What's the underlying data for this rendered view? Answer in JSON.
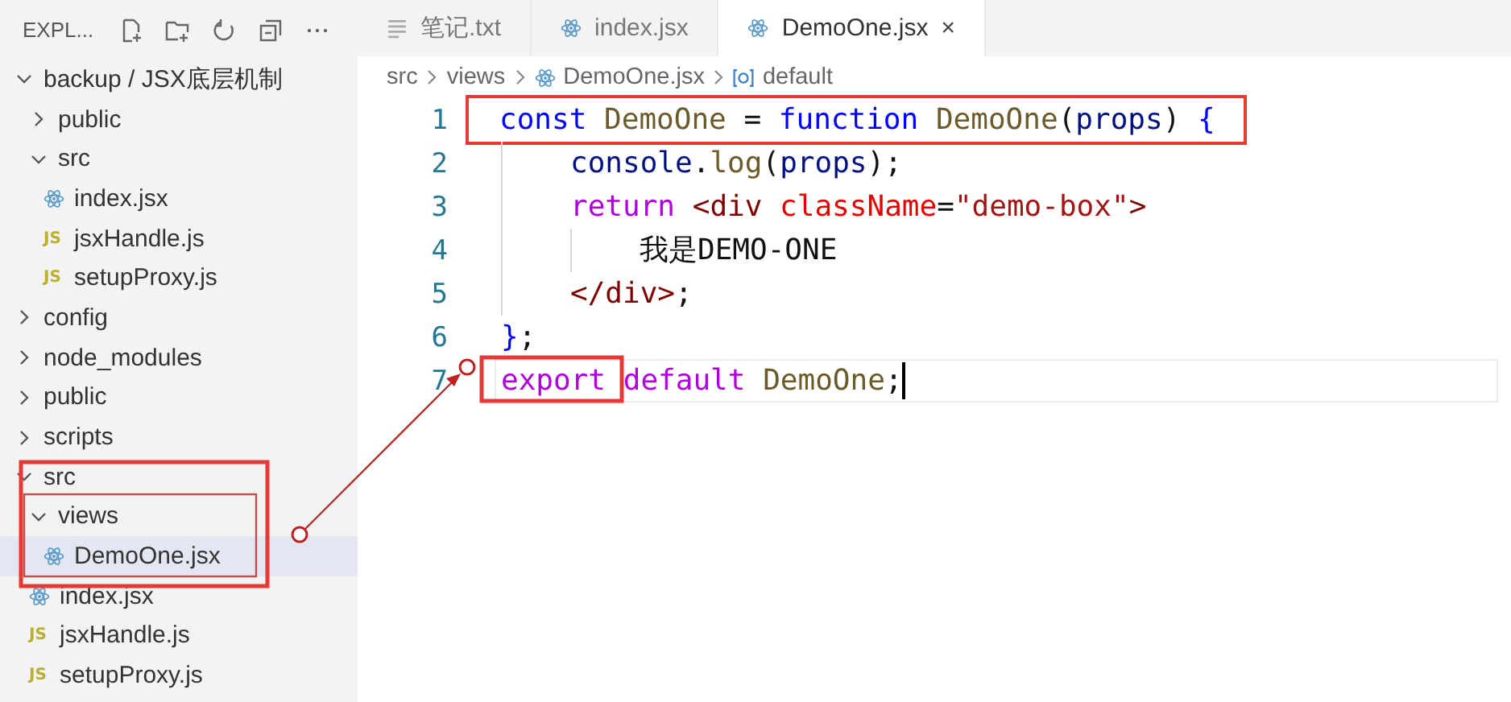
{
  "sidebar": {
    "title": "EXPL...",
    "tree": [
      {
        "label": "backup / JSX底层机制",
        "kind": "folder",
        "expanded": true,
        "selected": false,
        "children": [
          {
            "label": "public",
            "kind": "folder",
            "expanded": false,
            "selected": false
          },
          {
            "label": "src",
            "kind": "folder",
            "expanded": true,
            "selected": false,
            "children": [
              {
                "label": "index.jsx",
                "kind": "jsx",
                "selected": false
              },
              {
                "label": "jsxHandle.js",
                "kind": "js",
                "badge": "JS",
                "selected": false
              },
              {
                "label": "setupProxy.js",
                "kind": "js",
                "badge": "JS",
                "selected": false
              }
            ]
          }
        ]
      },
      {
        "label": "config",
        "kind": "folder",
        "expanded": false,
        "selected": false
      },
      {
        "label": "node_modules",
        "kind": "folder",
        "expanded": false,
        "selected": false
      },
      {
        "label": "public",
        "kind": "folder",
        "expanded": false,
        "selected": false
      },
      {
        "label": "scripts",
        "kind": "folder",
        "expanded": false,
        "selected": false
      },
      {
        "label": "src",
        "kind": "folder",
        "expanded": true,
        "selected": false,
        "children": [
          {
            "label": "views",
            "kind": "folder",
            "expanded": true,
            "selected": false,
            "children": [
              {
                "label": "DemoOne.jsx",
                "kind": "jsx",
                "selected": true
              }
            ]
          },
          {
            "label": "index.jsx",
            "kind": "jsx",
            "selected": false
          },
          {
            "label": "jsxHandle.js",
            "kind": "js",
            "badge": "JS",
            "selected": false
          },
          {
            "label": "setupProxy.js",
            "kind": "js",
            "badge": "JS",
            "selected": false
          }
        ]
      }
    ]
  },
  "tabs": [
    {
      "label": "笔记.txt",
      "kind": "txt",
      "selected": false
    },
    {
      "label": "index.jsx",
      "kind": "jsx",
      "selected": false
    },
    {
      "label": "DemoOne.jsx",
      "kind": "jsx",
      "selected": true,
      "close": "×"
    }
  ],
  "breadcrumb": [
    {
      "label": "src",
      "kind": "folder"
    },
    {
      "label": "views",
      "kind": "folder"
    },
    {
      "label": "DemoOne.jsx",
      "kind": "jsx"
    },
    {
      "label": "default",
      "kind": "variable"
    }
  ],
  "code": [
    {
      "number": "1",
      "current": false,
      "marked": true,
      "tokens": [
        {
          "text": "const ",
          "kind": "keyword"
        },
        {
          "text": "DemoOne",
          "kind": "function"
        },
        {
          "text": " = ",
          "kind": "plain"
        },
        {
          "text": "function ",
          "kind": "keyword"
        },
        {
          "text": "DemoOne",
          "kind": "function"
        },
        {
          "text": "(",
          "kind": "plain"
        },
        {
          "text": "props",
          "kind": "variable"
        },
        {
          "text": ") ",
          "kind": "plain"
        },
        {
          "text": "{",
          "kind": "bracket"
        }
      ],
      "children": [
        {
          "number": "2",
          "current": false,
          "tokens": [
            {
              "text": "console",
              "kind": "variable"
            },
            {
              "text": ".",
              "kind": "plain"
            },
            {
              "text": "log",
              "kind": "function"
            },
            {
              "text": "(",
              "kind": "plain"
            },
            {
              "text": "props",
              "kind": "variable"
            },
            {
              "text": ");",
              "kind": "plain"
            }
          ]
        },
        {
          "number": "3",
          "current": false,
          "tokens": [
            {
              "text": "return ",
              "kind": "control"
            },
            {
              "text": "<div ",
              "kind": "tag"
            },
            {
              "text": "className",
              "kind": "attribute"
            },
            {
              "text": "=",
              "kind": "plain"
            },
            {
              "text": "\"demo-box\"",
              "kind": "string"
            },
            {
              "text": ">",
              "kind": "tag"
            }
          ],
          "children": [
            {
              "number": "4",
              "current": false,
              "tokens": [
                {
                  "text": "我是DEMO-ONE",
                  "kind": "plain"
                }
              ]
            }
          ]
        },
        {
          "number": "5",
          "current": false,
          "tokens": [
            {
              "text": "</div>",
              "kind": "tag"
            },
            {
              "text": ";",
              "kind": "plain"
            }
          ]
        }
      ]
    },
    {
      "number": "6",
      "current": false,
      "tokens": [
        {
          "text": "}",
          "kind": "bracket"
        },
        {
          "text": ";",
          "kind": "plain"
        }
      ]
    },
    {
      "number": "7",
      "current": true,
      "tokens": [
        {
          "text": "export default ",
          "kind": "control"
        },
        {
          "text": "DemoOne",
          "kind": "function"
        },
        {
          "text": ";",
          "kind": "plain"
        }
      ]
    }
  ]
}
